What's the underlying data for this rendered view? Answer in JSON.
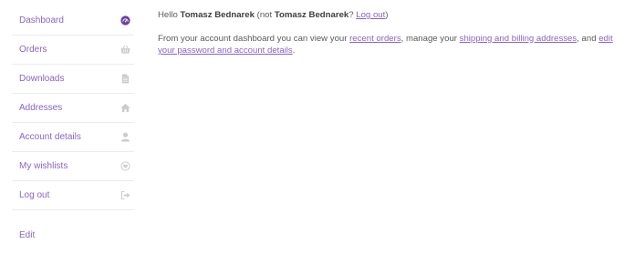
{
  "sidebar": {
    "items": [
      {
        "label": "Dashboard",
        "icon": "dashboard-gauge-icon"
      },
      {
        "label": "Orders",
        "icon": "basket-icon"
      },
      {
        "label": "Downloads",
        "icon": "file-icon"
      },
      {
        "label": "Addresses",
        "icon": "home-icon"
      },
      {
        "label": "Account details",
        "icon": "user-icon"
      },
      {
        "label": "My wishlists",
        "icon": "heart-circle-icon"
      },
      {
        "label": "Log out",
        "icon": "sign-out-icon"
      }
    ],
    "edit_label": "Edit"
  },
  "main": {
    "greeting": {
      "hello": "Hello",
      "name": "Tomasz Bednarek",
      "not_open": "(not",
      "name_again": "Tomasz Bednarek",
      "question": "?",
      "logout_link": "Log out",
      "close": ")"
    },
    "intro": {
      "text1": "From your account dashboard you can view your",
      "link_orders": "recent orders",
      "text2": ", manage your",
      "link_addresses": "shipping and billing addresses",
      "text3": ", and",
      "link_details": "edit your password and account details",
      "text4": "."
    }
  },
  "colors": {
    "accent": "#8a63c5",
    "active_icon": "#6b3fa6",
    "inactive_icon": "#cccccc",
    "body_text": "#5a5a5a"
  }
}
